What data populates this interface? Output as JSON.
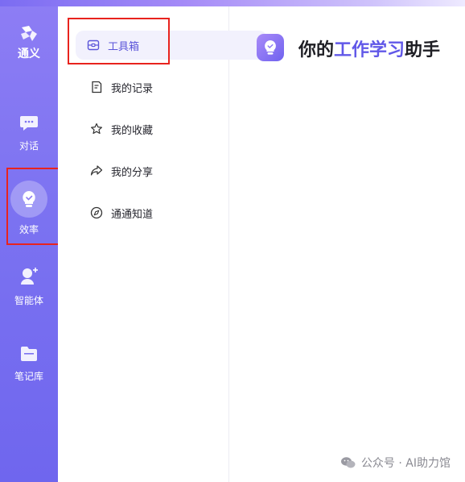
{
  "rail": {
    "logo_text": "通义",
    "items": [
      {
        "label": "对话",
        "icon": "chat-icon"
      },
      {
        "label": "效率",
        "icon": "bulb-icon"
      },
      {
        "label": "智能体",
        "icon": "agent-icon"
      },
      {
        "label": "笔记库",
        "icon": "folder-icon"
      }
    ]
  },
  "menu": {
    "items": [
      {
        "label": "工具箱",
        "icon": "toolbox-icon"
      },
      {
        "label": "我的记录",
        "icon": "record-icon"
      },
      {
        "label": "我的收藏",
        "icon": "star-icon"
      },
      {
        "label": "我的分享",
        "icon": "share-icon"
      },
      {
        "label": "通通知道",
        "icon": "compass-icon"
      }
    ]
  },
  "main": {
    "title_prefix": "你的",
    "title_highlight": "工作学习",
    "title_suffix": "助手"
  },
  "watermark": {
    "text": "公众号 · AI助力馆"
  },
  "colors": {
    "accent": "#6158e8",
    "rail_start": "#8d7df4",
    "rail_end": "#6f66ee",
    "annotation_red": "#e8231e"
  }
}
